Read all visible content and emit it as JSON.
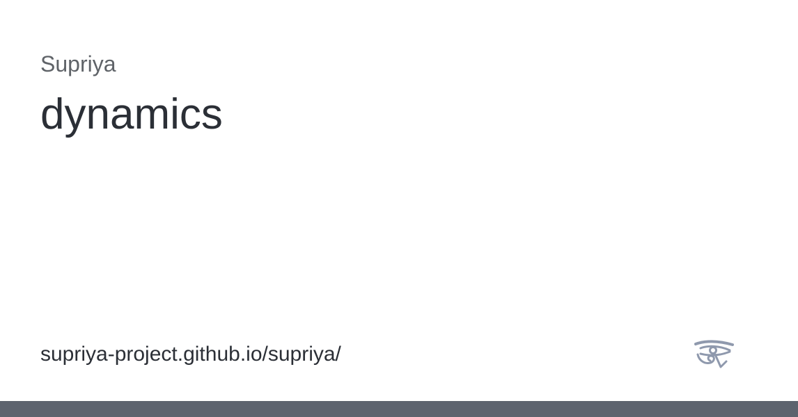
{
  "card": {
    "site_name": "Supriya",
    "title": "dynamics",
    "url": "supriya-project.github.io/supriya/",
    "logo_icon": "eye-of-horus-icon"
  },
  "colors": {
    "background": "#ffffff",
    "site_name_text": "#5f6368",
    "title_text": "#2b2f36",
    "logo": "#8f99ad",
    "bottom_bar": "#5d636e"
  }
}
